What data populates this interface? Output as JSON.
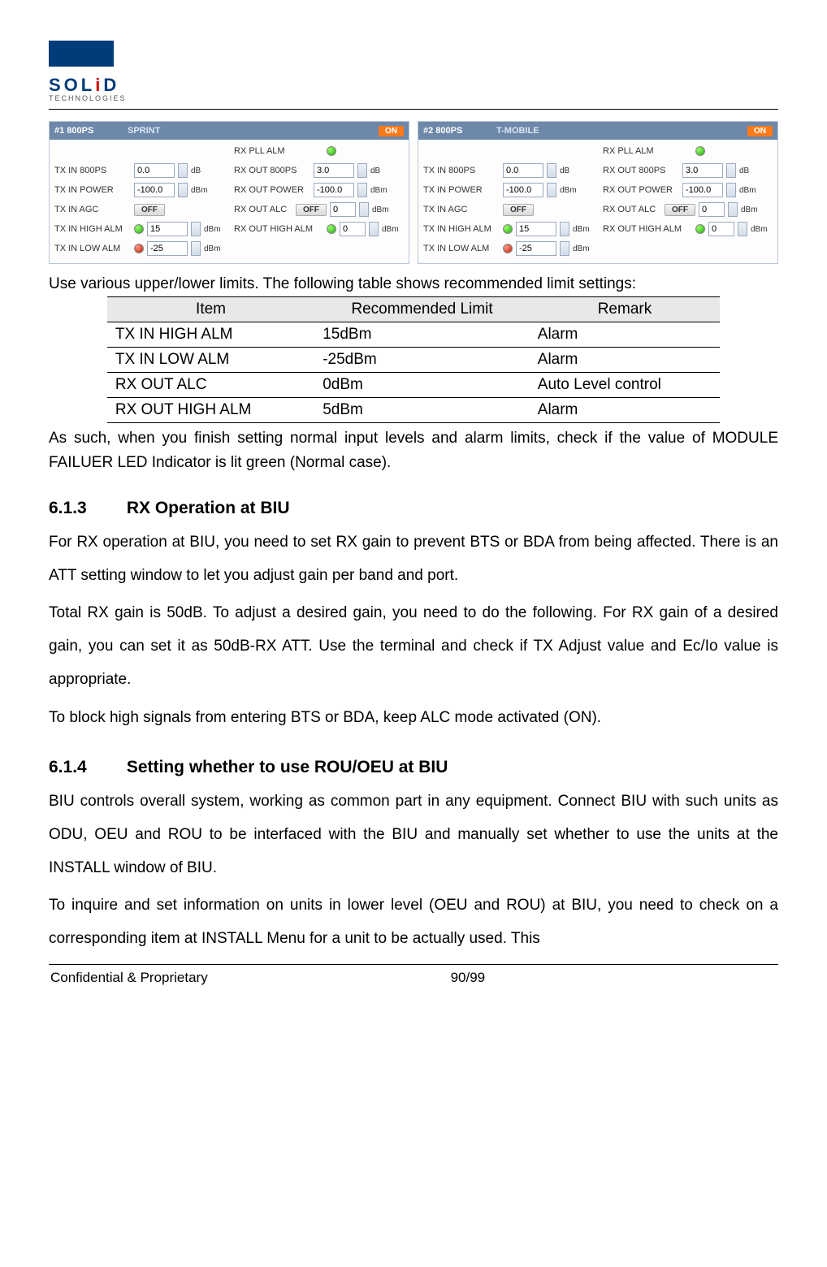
{
  "logo": {
    "text_pre": "SOL",
    "text_red": "i",
    "text_post": "D",
    "sub": "TECHNOLOGIES"
  },
  "panels": [
    {
      "id": "#1 800PS",
      "carrier": "SPRINT",
      "on": "ON",
      "left": {
        "tx_in_800ps": {
          "label": "TX IN 800PS",
          "value": "0.0",
          "unit": "dB"
        },
        "tx_in_power": {
          "label": "TX IN POWER",
          "value": "-100.0",
          "unit": "dBm"
        },
        "tx_in_agc": {
          "label": "TX IN AGC",
          "badge": "OFF"
        },
        "tx_in_high": {
          "label": "TX IN HIGH ALM",
          "led": "green",
          "value": "15",
          "unit": "dBm"
        },
        "tx_in_low": {
          "label": "TX IN LOW ALM",
          "led": "red",
          "value": "-25",
          "unit": "dBm"
        }
      },
      "right": {
        "rx_pll_alm": {
          "label": "RX PLL ALM",
          "led": "green"
        },
        "rx_out_800ps": {
          "label": "RX OUT 800PS",
          "value": "3.0",
          "unit": "dB"
        },
        "rx_out_power": {
          "label": "RX OUT POWER",
          "value": "-100.0",
          "unit": "dBm"
        },
        "rx_out_alc": {
          "label": "RX OUT ALC",
          "badge": "OFF",
          "value": "0",
          "unit": "dBm"
        },
        "rx_out_high": {
          "label": "RX OUT HIGH ALM",
          "led": "green",
          "value": "0",
          "unit": "dBm"
        }
      }
    },
    {
      "id": "#2 800PS",
      "carrier": "T-MOBILE",
      "on": "ON",
      "left": {
        "tx_in_800ps": {
          "label": "TX IN 800PS",
          "value": "0.0",
          "unit": "dB"
        },
        "tx_in_power": {
          "label": "TX IN POWER",
          "value": "-100.0",
          "unit": "dBm"
        },
        "tx_in_agc": {
          "label": "TX IN AGC",
          "badge": "OFF"
        },
        "tx_in_high": {
          "label": "TX IN HIGH ALM",
          "led": "green",
          "value": "15",
          "unit": "dBm"
        },
        "tx_in_low": {
          "label": "TX IN LOW ALM",
          "led": "red",
          "value": "-25",
          "unit": "dBm"
        }
      },
      "right": {
        "rx_pll_alm": {
          "label": "RX PLL ALM",
          "led": "green"
        },
        "rx_out_800ps": {
          "label": "RX OUT 800PS",
          "value": "3.0",
          "unit": "dB"
        },
        "rx_out_power": {
          "label": "RX OUT POWER",
          "value": "-100.0",
          "unit": "dBm"
        },
        "rx_out_alc": {
          "label": "RX OUT ALC",
          "badge": "OFF",
          "value": "0",
          "unit": "dBm"
        },
        "rx_out_high": {
          "label": "RX OUT HIGH ALM",
          "led": "green",
          "value": "0",
          "unit": "dBm"
        }
      }
    }
  ],
  "caption": "Use various upper/lower limits. The following table shows recommended limit settings:",
  "table": {
    "headers": [
      "Item",
      "Recommended Limit",
      "Remark"
    ],
    "rows": [
      [
        "TX IN HIGH ALM",
        "15dBm",
        "Alarm"
      ],
      [
        "TX IN LOW ALM",
        "-25dBm",
        "Alarm"
      ],
      [
        "RX OUT ALC",
        "0dBm",
        "Auto Level control"
      ],
      [
        "RX OUT HIGH ALM",
        "5dBm",
        "Alarm"
      ]
    ]
  },
  "para1": "As such, when you finish setting normal input levels and alarm limits, check if the value of MODULE FAILUER LED Indicator is lit green (Normal case).",
  "sec613": {
    "num": "6.1.3",
    "title": "RX Operation at BIU"
  },
  "para613a": "For RX operation at BIU, you need to set RX gain to prevent BTS or BDA from being affected. There is an ATT setting window to let you adjust gain per band and port.",
  "para613b": "Total RX gain is 50dB. To adjust a desired gain, you need to do the following. For RX gain of a desired gain, you can set it as 50dB-RX ATT. Use the terminal and check if TX Adjust value and Ec/Io value is appropriate.",
  "para613c": "To block high signals from entering BTS or BDA, keep ALC mode activated (ON).",
  "sec614": {
    "num": "6.1.4",
    "title": "Setting whether to use ROU/OEU at BIU"
  },
  "para614a": "BIU controls overall system, working as common part in any equipment. Connect BIU with such units as ODU, OEU and ROU to be interfaced with the BIU and manually set whether to use the units at the INSTALL window of BIU.",
  "para614b": "To inquire and set information on units in lower level (OEU and ROU) at BIU, you need to check on a corresponding item at INSTALL Menu for a unit to be actually used. This",
  "footer": {
    "left": "Confidential & Proprietary",
    "right": "90/99"
  }
}
